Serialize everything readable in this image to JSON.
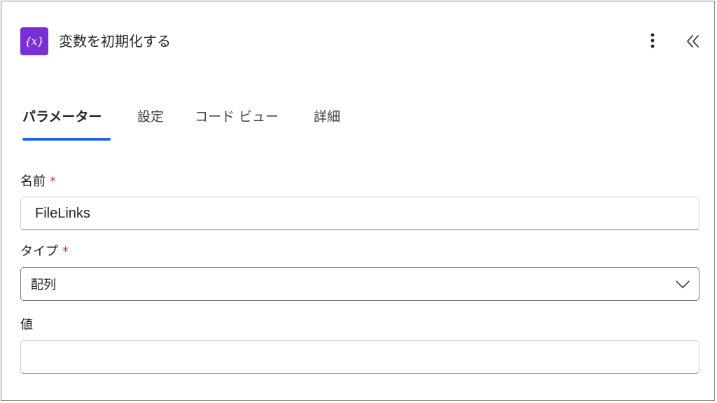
{
  "header": {
    "icon": "variable-icon",
    "icon_glyph": "{x}",
    "icon_color": "#7a2fd6",
    "title": "変数を初期化する",
    "more_icon": "more-vertical-icon",
    "collapse_icon": "double-chevron-left-icon"
  },
  "tabs": [
    {
      "label": "パラメーター",
      "active": true
    },
    {
      "label": "設定",
      "active": false
    },
    {
      "label": "コード ビュー",
      "active": false
    },
    {
      "label": "詳細",
      "active": false
    }
  ],
  "form": {
    "name": {
      "label": "名前",
      "required_mark": "*",
      "value": "FileLinks"
    },
    "type": {
      "label": "タイプ",
      "required_mark": "*",
      "value": "配列"
    },
    "value": {
      "label": "値",
      "value": ""
    }
  },
  "colors": {
    "accent": "#1f62e8",
    "required": "#c4314b"
  }
}
